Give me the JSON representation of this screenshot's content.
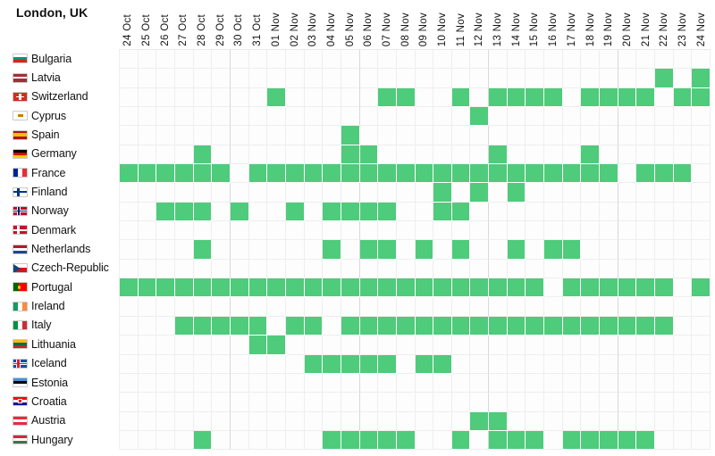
{
  "header": {
    "title": "London, UK"
  },
  "columns": [
    "24 Oct",
    "25 Oct",
    "26 Oct",
    "27 Oct",
    "28 Oct",
    "29 Oct",
    "30 Oct",
    "31 Oct",
    "01 Nov",
    "02 Nov",
    "03 Nov",
    "04 Nov",
    "05 Nov",
    "06 Nov",
    "07 Nov",
    "08 Nov",
    "09 Nov",
    "10 Nov",
    "11 Nov",
    "12 Nov",
    "13 Nov",
    "14 Nov",
    "15 Nov",
    "16 Nov",
    "17 Nov",
    "18 Nov",
    "19 Nov",
    "20 Nov",
    "21 Nov",
    "22 Nov",
    "23 Nov",
    "24 Nov"
  ],
  "colors": {
    "filled": "#4ecb7b",
    "empty": "#fdfdfd",
    "gridline": "#eeeeee",
    "text": "#101010"
  },
  "rows": [
    {
      "country": "Bulgaria",
      "flag": "flag-bulgaria",
      "values": [
        0,
        0,
        0,
        0,
        0,
        0,
        0,
        0,
        0,
        0,
        0,
        0,
        0,
        0,
        0,
        0,
        0,
        0,
        0,
        0,
        0,
        0,
        0,
        0,
        0,
        0,
        0,
        0,
        0,
        0,
        0,
        0
      ]
    },
    {
      "country": "Latvia",
      "flag": "flag-latvia",
      "values": [
        0,
        0,
        0,
        0,
        0,
        0,
        0,
        0,
        0,
        0,
        0,
        0,
        0,
        0,
        0,
        0,
        0,
        0,
        0,
        0,
        0,
        0,
        0,
        0,
        0,
        0,
        0,
        0,
        0,
        1,
        0,
        1
      ]
    },
    {
      "country": "Switzerland",
      "flag": "flag-switzerland",
      "values": [
        0,
        0,
        0,
        0,
        0,
        0,
        0,
        0,
        1,
        0,
        0,
        0,
        0,
        0,
        1,
        1,
        0,
        0,
        1,
        0,
        1,
        1,
        1,
        1,
        0,
        1,
        1,
        1,
        1,
        0,
        1,
        1
      ]
    },
    {
      "country": "Cyprus",
      "flag": "flag-cyprus",
      "values": [
        0,
        0,
        0,
        0,
        0,
        0,
        0,
        0,
        0,
        0,
        0,
        0,
        0,
        0,
        0,
        0,
        0,
        0,
        0,
        1,
        0,
        0,
        0,
        0,
        0,
        0,
        0,
        0,
        0,
        0,
        0,
        0
      ]
    },
    {
      "country": "Spain",
      "flag": "flag-spain",
      "values": [
        0,
        0,
        0,
        0,
        0,
        0,
        0,
        0,
        0,
        0,
        0,
        0,
        1,
        0,
        0,
        0,
        0,
        0,
        0,
        0,
        0,
        0,
        0,
        0,
        0,
        0,
        0,
        0,
        0,
        0,
        0,
        0
      ]
    },
    {
      "country": "Germany",
      "flag": "flag-germany",
      "values": [
        0,
        0,
        0,
        0,
        1,
        0,
        0,
        0,
        0,
        0,
        0,
        0,
        1,
        1,
        0,
        0,
        0,
        0,
        0,
        0,
        1,
        0,
        0,
        0,
        0,
        1,
        0,
        0,
        0,
        0,
        0,
        0
      ]
    },
    {
      "country": "France",
      "flag": "flag-france",
      "values": [
        1,
        1,
        1,
        1,
        1,
        1,
        0,
        1,
        1,
        1,
        1,
        1,
        1,
        1,
        1,
        1,
        1,
        1,
        1,
        1,
        1,
        1,
        1,
        1,
        1,
        1,
        1,
        0,
        1,
        1,
        1,
        0
      ]
    },
    {
      "country": "Finland",
      "flag": "flag-finland",
      "values": [
        0,
        0,
        0,
        0,
        0,
        0,
        0,
        0,
        0,
        0,
        0,
        0,
        0,
        0,
        0,
        0,
        0,
        1,
        0,
        1,
        0,
        1,
        0,
        0,
        0,
        0,
        0,
        0,
        0,
        0,
        0,
        0
      ]
    },
    {
      "country": "Norway",
      "flag": "flag-norway",
      "values": [
        0,
        0,
        1,
        1,
        1,
        0,
        1,
        0,
        0,
        1,
        0,
        1,
        1,
        1,
        1,
        0,
        0,
        1,
        1,
        0,
        0,
        0,
        0,
        0,
        0,
        0,
        0,
        0,
        0,
        0,
        0,
        0
      ]
    },
    {
      "country": "Denmark",
      "flag": "flag-denmark",
      "values": [
        0,
        0,
        0,
        0,
        0,
        0,
        0,
        0,
        0,
        0,
        0,
        0,
        0,
        0,
        0,
        0,
        0,
        0,
        0,
        0,
        0,
        0,
        0,
        0,
        0,
        0,
        0,
        0,
        0,
        0,
        0,
        0
      ]
    },
    {
      "country": "Netherlands",
      "flag": "flag-netherlands",
      "values": [
        0,
        0,
        0,
        0,
        1,
        0,
        0,
        0,
        0,
        0,
        0,
        1,
        0,
        1,
        1,
        0,
        1,
        0,
        1,
        0,
        0,
        1,
        0,
        1,
        1,
        0,
        0,
        0,
        0,
        0,
        0,
        0
      ]
    },
    {
      "country": "Czech-Republic",
      "flag": "flag-czech",
      "values": [
        0,
        0,
        0,
        0,
        0,
        0,
        0,
        0,
        0,
        0,
        0,
        0,
        0,
        0,
        0,
        0,
        0,
        0,
        0,
        0,
        0,
        0,
        0,
        0,
        0,
        0,
        0,
        0,
        0,
        0,
        0,
        0
      ]
    },
    {
      "country": "Portugal",
      "flag": "flag-portugal",
      "values": [
        1,
        1,
        1,
        1,
        1,
        1,
        1,
        1,
        1,
        1,
        1,
        1,
        1,
        1,
        1,
        1,
        1,
        1,
        1,
        1,
        1,
        1,
        1,
        0,
        1,
        1,
        1,
        1,
        1,
        1,
        0,
        1
      ]
    },
    {
      "country": "Ireland",
      "flag": "flag-ireland",
      "values": [
        0,
        0,
        0,
        0,
        0,
        0,
        0,
        0,
        0,
        0,
        0,
        0,
        0,
        0,
        0,
        0,
        0,
        0,
        0,
        0,
        0,
        0,
        0,
        0,
        0,
        0,
        0,
        0,
        0,
        0,
        0,
        0
      ]
    },
    {
      "country": "Italy",
      "flag": "flag-italy",
      "values": [
        0,
        0,
        0,
        1,
        1,
        1,
        1,
        1,
        0,
        1,
        1,
        0,
        1,
        1,
        1,
        1,
        1,
        1,
        1,
        1,
        1,
        1,
        1,
        1,
        1,
        1,
        1,
        1,
        1,
        1,
        0,
        0
      ]
    },
    {
      "country": "Lithuania",
      "flag": "flag-lithuania",
      "values": [
        0,
        0,
        0,
        0,
        0,
        0,
        0,
        1,
        1,
        0,
        0,
        0,
        0,
        0,
        0,
        0,
        0,
        0,
        0,
        0,
        0,
        0,
        0,
        0,
        0,
        0,
        0,
        0,
        0,
        0,
        0,
        0
      ]
    },
    {
      "country": "Iceland",
      "flag": "flag-iceland",
      "values": [
        0,
        0,
        0,
        0,
        0,
        0,
        0,
        0,
        0,
        0,
        1,
        1,
        1,
        1,
        1,
        0,
        1,
        1,
        0,
        0,
        0,
        0,
        0,
        0,
        0,
        0,
        0,
        0,
        0,
        0,
        0,
        0
      ]
    },
    {
      "country": "Estonia",
      "flag": "flag-estonia",
      "values": [
        0,
        0,
        0,
        0,
        0,
        0,
        0,
        0,
        0,
        0,
        0,
        0,
        0,
        0,
        0,
        0,
        0,
        0,
        0,
        0,
        0,
        0,
        0,
        0,
        0,
        0,
        0,
        0,
        0,
        0,
        0,
        0
      ]
    },
    {
      "country": "Croatia",
      "flag": "flag-croatia",
      "values": [
        0,
        0,
        0,
        0,
        0,
        0,
        0,
        0,
        0,
        0,
        0,
        0,
        0,
        0,
        0,
        0,
        0,
        0,
        0,
        0,
        0,
        0,
        0,
        0,
        0,
        0,
        0,
        0,
        0,
        0,
        0,
        0
      ]
    },
    {
      "country": "Austria",
      "flag": "flag-austria",
      "values": [
        0,
        0,
        0,
        0,
        0,
        0,
        0,
        0,
        0,
        0,
        0,
        0,
        0,
        0,
        0,
        0,
        0,
        0,
        0,
        1,
        1,
        0,
        0,
        0,
        0,
        0,
        0,
        0,
        0,
        0,
        0,
        0
      ]
    },
    {
      "country": "Hungary",
      "flag": "flag-hungary",
      "values": [
        0,
        0,
        0,
        0,
        1,
        0,
        0,
        0,
        0,
        0,
        0,
        1,
        1,
        1,
        1,
        1,
        0,
        0,
        1,
        0,
        1,
        1,
        1,
        0,
        1,
        1,
        1,
        1,
        1,
        0,
        0,
        0
      ]
    }
  ],
  "chart_data": {
    "type": "heatmap",
    "title": "London, UK",
    "xlabel": "",
    "ylabel": "",
    "x": [
      "24 Oct",
      "25 Oct",
      "26 Oct",
      "27 Oct",
      "28 Oct",
      "29 Oct",
      "30 Oct",
      "31 Oct",
      "01 Nov",
      "02 Nov",
      "03 Nov",
      "04 Nov",
      "05 Nov",
      "06 Nov",
      "07 Nov",
      "08 Nov",
      "09 Nov",
      "10 Nov",
      "11 Nov",
      "12 Nov",
      "13 Nov",
      "14 Nov",
      "15 Nov",
      "16 Nov",
      "17 Nov",
      "18 Nov",
      "19 Nov",
      "20 Nov",
      "21 Nov",
      "22 Nov",
      "23 Nov",
      "24 Nov"
    ],
    "y": [
      "Bulgaria",
      "Latvia",
      "Switzerland",
      "Cyprus",
      "Spain",
      "Germany",
      "France",
      "Finland",
      "Norway",
      "Denmark",
      "Netherlands",
      "Czech-Republic",
      "Portugal",
      "Ireland",
      "Italy",
      "Lithuania",
      "Iceland",
      "Estonia",
      "Croatia",
      "Austria",
      "Hungary"
    ],
    "values": [
      [
        0,
        0,
        0,
        0,
        0,
        0,
        0,
        0,
        0,
        0,
        0,
        0,
        0,
        0,
        0,
        0,
        0,
        0,
        0,
        0,
        0,
        0,
        0,
        0,
        0,
        0,
        0,
        0,
        0,
        0,
        0,
        0
      ],
      [
        0,
        0,
        0,
        0,
        0,
        0,
        0,
        0,
        0,
        0,
        0,
        0,
        0,
        0,
        0,
        0,
        0,
        0,
        0,
        0,
        0,
        0,
        0,
        0,
        0,
        0,
        0,
        0,
        0,
        1,
        0,
        1
      ],
      [
        0,
        0,
        0,
        0,
        0,
        0,
        0,
        0,
        1,
        0,
        0,
        0,
        0,
        0,
        1,
        1,
        0,
        0,
        1,
        0,
        1,
        1,
        1,
        1,
        0,
        1,
        1,
        1,
        1,
        0,
        1,
        1
      ],
      [
        0,
        0,
        0,
        0,
        0,
        0,
        0,
        0,
        0,
        0,
        0,
        0,
        0,
        0,
        0,
        0,
        0,
        0,
        0,
        1,
        0,
        0,
        0,
        0,
        0,
        0,
        0,
        0,
        0,
        0,
        0,
        0
      ],
      [
        0,
        0,
        0,
        0,
        0,
        0,
        0,
        0,
        0,
        0,
        0,
        0,
        1,
        0,
        0,
        0,
        0,
        0,
        0,
        0,
        0,
        0,
        0,
        0,
        0,
        0,
        0,
        0,
        0,
        0,
        0,
        0
      ],
      [
        0,
        0,
        0,
        0,
        1,
        0,
        0,
        0,
        0,
        0,
        0,
        0,
        1,
        1,
        0,
        0,
        0,
        0,
        0,
        0,
        1,
        0,
        0,
        0,
        0,
        1,
        0,
        0,
        0,
        0,
        0,
        0
      ],
      [
        1,
        1,
        1,
        1,
        1,
        1,
        0,
        1,
        1,
        1,
        1,
        1,
        1,
        1,
        1,
        1,
        1,
        1,
        1,
        1,
        1,
        1,
        1,
        1,
        1,
        1,
        1,
        0,
        1,
        1,
        1,
        0
      ],
      [
        0,
        0,
        0,
        0,
        0,
        0,
        0,
        0,
        0,
        0,
        0,
        0,
        0,
        0,
        0,
        0,
        0,
        1,
        0,
        1,
        0,
        1,
        0,
        0,
        0,
        0,
        0,
        0,
        0,
        0,
        0,
        0
      ],
      [
        0,
        0,
        1,
        1,
        1,
        0,
        1,
        0,
        0,
        1,
        0,
        1,
        1,
        1,
        1,
        0,
        0,
        1,
        1,
        0,
        0,
        0,
        0,
        0,
        0,
        0,
        0,
        0,
        0,
        0,
        0,
        0
      ],
      [
        0,
        0,
        0,
        0,
        0,
        0,
        0,
        0,
        0,
        0,
        0,
        0,
        0,
        0,
        0,
        0,
        0,
        0,
        0,
        0,
        0,
        0,
        0,
        0,
        0,
        0,
        0,
        0,
        0,
        0,
        0,
        0
      ],
      [
        0,
        0,
        0,
        0,
        1,
        0,
        0,
        0,
        0,
        0,
        0,
        1,
        0,
        1,
        1,
        0,
        1,
        0,
        1,
        0,
        0,
        1,
        0,
        1,
        1,
        0,
        0,
        0,
        0,
        0,
        0,
        0
      ],
      [
        0,
        0,
        0,
        0,
        0,
        0,
        0,
        0,
        0,
        0,
        0,
        0,
        0,
        0,
        0,
        0,
        0,
        0,
        0,
        0,
        0,
        0,
        0,
        0,
        0,
        0,
        0,
        0,
        0,
        0,
        0,
        0
      ],
      [
        1,
        1,
        1,
        1,
        1,
        1,
        1,
        1,
        1,
        1,
        1,
        1,
        1,
        1,
        1,
        1,
        1,
        1,
        1,
        1,
        1,
        1,
        1,
        0,
        1,
        1,
        1,
        1,
        1,
        1,
        0,
        1
      ],
      [
        0,
        0,
        0,
        0,
        0,
        0,
        0,
        0,
        0,
        0,
        0,
        0,
        0,
        0,
        0,
        0,
        0,
        0,
        0,
        0,
        0,
        0,
        0,
        0,
        0,
        0,
        0,
        0,
        0,
        0,
        0,
        0
      ],
      [
        0,
        0,
        0,
        1,
        1,
        1,
        1,
        1,
        0,
        1,
        1,
        0,
        1,
        1,
        1,
        1,
        1,
        1,
        1,
        1,
        1,
        1,
        1,
        1,
        1,
        1,
        1,
        1,
        1,
        1,
        0,
        0
      ],
      [
        0,
        0,
        0,
        0,
        0,
        0,
        0,
        1,
        1,
        0,
        0,
        0,
        0,
        0,
        0,
        0,
        0,
        0,
        0,
        0,
        0,
        0,
        0,
        0,
        0,
        0,
        0,
        0,
        0,
        0,
        0,
        0
      ],
      [
        0,
        0,
        0,
        0,
        0,
        0,
        0,
        0,
        0,
        0,
        1,
        1,
        1,
        1,
        1,
        0,
        1,
        1,
        0,
        0,
        0,
        0,
        0,
        0,
        0,
        0,
        0,
        0,
        0,
        0,
        0,
        0
      ],
      [
        0,
        0,
        0,
        0,
        0,
        0,
        0,
        0,
        0,
        0,
        0,
        0,
        0,
        0,
        0,
        0,
        0,
        0,
        0,
        0,
        0,
        0,
        0,
        0,
        0,
        0,
        0,
        0,
        0,
        0,
        0,
        0
      ],
      [
        0,
        0,
        0,
        0,
        0,
        0,
        0,
        0,
        0,
        0,
        0,
        0,
        0,
        0,
        0,
        0,
        0,
        0,
        0,
        0,
        0,
        0,
        0,
        0,
        0,
        0,
        0,
        0,
        0,
        0,
        0,
        0
      ],
      [
        0,
        0,
        0,
        0,
        0,
        0,
        0,
        0,
        0,
        0,
        0,
        0,
        0,
        0,
        0,
        0,
        0,
        0,
        0,
        1,
        1,
        0,
        0,
        0,
        0,
        0,
        0,
        0,
        0,
        0,
        0,
        0
      ],
      [
        0,
        0,
        0,
        0,
        1,
        0,
        0,
        0,
        0,
        0,
        0,
        1,
        1,
        1,
        1,
        1,
        0,
        0,
        1,
        0,
        1,
        1,
        1,
        0,
        1,
        1,
        1,
        1,
        1,
        0,
        0,
        0
      ]
    ],
    "legend": [
      "0 = no marker (white)",
      "1 = marker (green)"
    ],
    "grid": true
  }
}
